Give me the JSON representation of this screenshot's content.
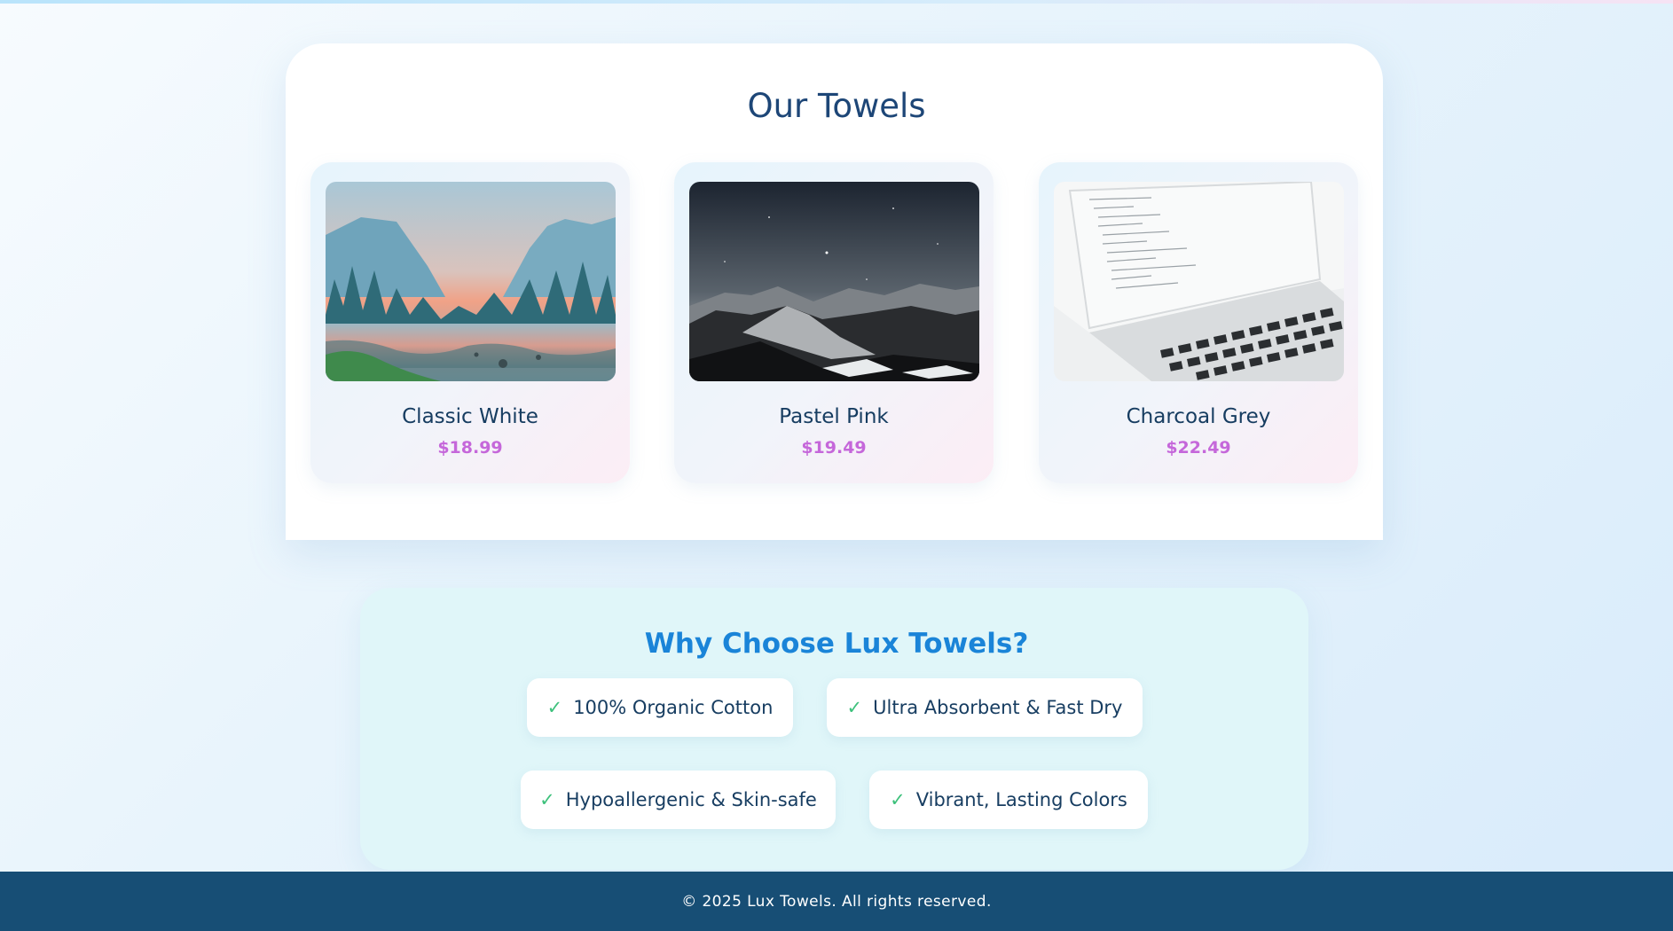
{
  "products": {
    "title": "Our Towels",
    "items": [
      {
        "name": "Classic White",
        "price": "$18.99",
        "image": "mountain-valley-river-photo"
      },
      {
        "name": "Pastel Pink",
        "price": "$19.49",
        "image": "night-sky-mountains-photo"
      },
      {
        "name": "Charcoal Grey",
        "price": "$22.49",
        "image": "laptop-code-photo"
      }
    ]
  },
  "why": {
    "title": "Why Choose Lux Towels?",
    "check_symbol": "✓",
    "features": [
      "100% Organic Cotton",
      "Ultra Absorbent & Fast Dry",
      "Hypoallergenic & Skin-safe",
      "Vibrant, Lasting Colors"
    ]
  },
  "footer": {
    "text": "© 2025 Lux Towels. All rights reserved."
  },
  "colors": {
    "heading": "#1d4677",
    "price": "#c567da",
    "why_title": "#1a84d8",
    "check": "#3ec17c",
    "footer_bg": "#174e75"
  }
}
